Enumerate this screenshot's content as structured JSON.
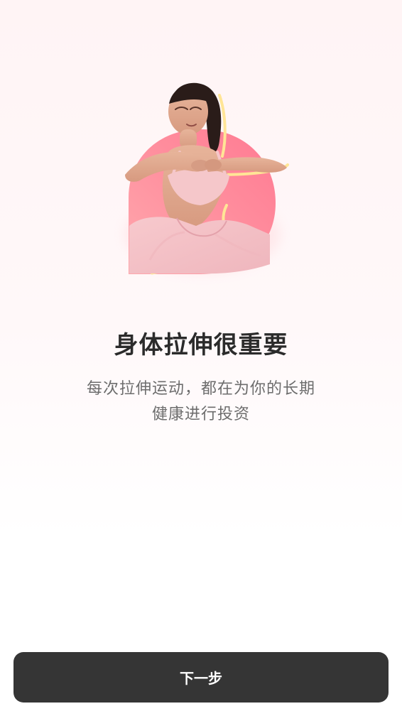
{
  "hero": {
    "title": "身体拉伸很重要",
    "subtitle": "每次拉伸运动，都在为你的长期健康进行投资"
  },
  "footer": {
    "next_label": "下一步"
  },
  "colors": {
    "button_bg": "#353535",
    "title_text": "#2b2b2b",
    "subtitle_text": "#6d6d6d",
    "accent_pink": "#ff8a99",
    "accent_yellow": "#ffe596"
  }
}
